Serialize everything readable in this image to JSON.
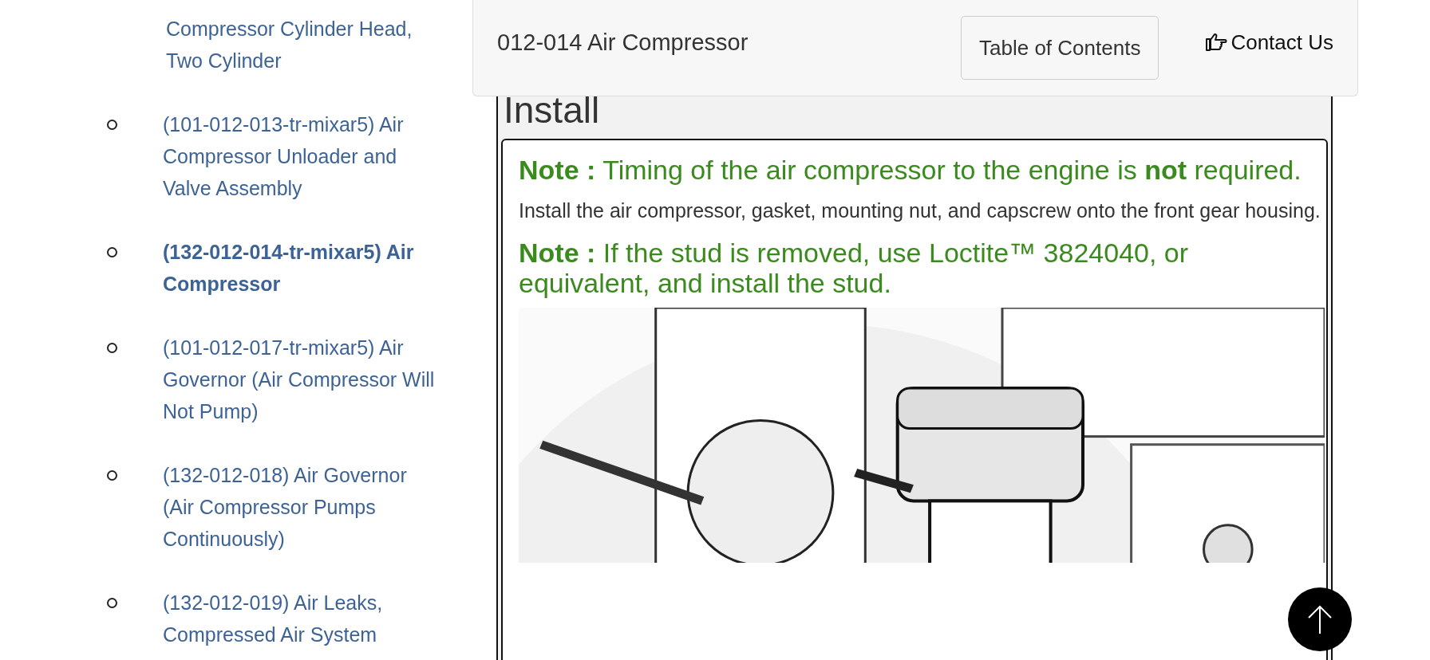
{
  "sidebar": {
    "partial_item": "Compressor Cylinder Head, Two Cylinder",
    "items": [
      {
        "text": "(101-012-013-tr-mixar5) Air Compressor Unloader and Valve Assembly",
        "selected": false
      },
      {
        "text": "(132-012-014-tr-mixar5) Air Compressor",
        "selected": true
      },
      {
        "text": "(101-012-017-tr-mixar5) Air Governor (Air Compressor Will Not Pump)",
        "selected": false
      },
      {
        "text": "(132-012-018) Air Governor (Air Compressor Pumps Continuously)",
        "selected": false
      },
      {
        "text": "(132-012-019) Air Leaks, Compressed Air System",
        "selected": false
      }
    ]
  },
  "header": {
    "title": "012-014 Air Compressor",
    "toc_button": "Table of Contents",
    "contact_link": "Contact Us"
  },
  "section": {
    "heading": "Install",
    "blocks": [
      {
        "kind": "note",
        "text": "**Note :** Timing of the air compressor to the engine is **not** required."
      },
      {
        "kind": "paragraph",
        "text": "Install the air compressor, gasket, mounting nut, and capscrew onto the front gear housing."
      },
      {
        "kind": "note",
        "text": "**Note :** If the stud is removed, use Loctite™ 3824040, or equivalent, and install the stud."
      },
      {
        "kind": "picture"
      }
    ]
  }
}
